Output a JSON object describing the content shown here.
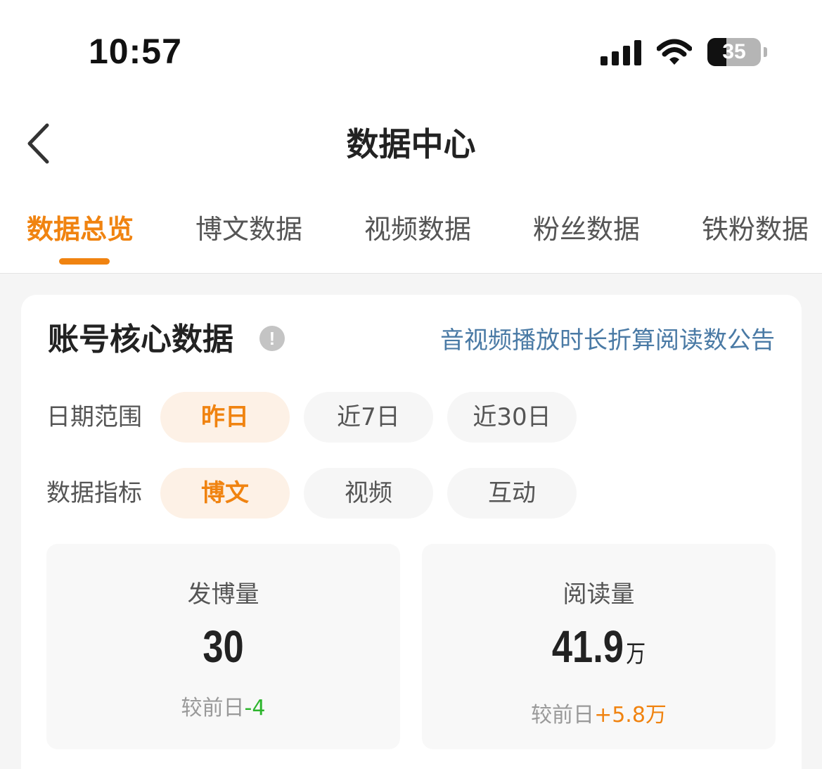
{
  "status_bar": {
    "time": "10:57",
    "battery": "35",
    "icons": [
      "signal-icon",
      "wifi-icon",
      "battery-icon"
    ]
  },
  "nav": {
    "back_icon": "chevron-left-icon",
    "title": "数据中心"
  },
  "tabs": [
    {
      "label": "数据总览",
      "active": true
    },
    {
      "label": "博文数据",
      "active": false
    },
    {
      "label": "视频数据",
      "active": false
    },
    {
      "label": "粉丝数据",
      "active": false
    },
    {
      "label": "铁粉数据",
      "active": false
    }
  ],
  "card": {
    "title": "账号核心数据",
    "info_icon": "exclamation-circle-icon",
    "notice_link": "音视频播放时长折算阅读数公告",
    "date_range": {
      "label": "日期范围",
      "options": [
        "昨日",
        "近7日",
        "近30日"
      ],
      "selected": "昨日"
    },
    "metric": {
      "label": "数据指标",
      "options": [
        "博文",
        "视频",
        "互动"
      ],
      "selected": "博文"
    },
    "stats": [
      {
        "label": "发博量",
        "value": "30",
        "unit": "",
        "compare_prefix": "较前日",
        "compare_value": "-4"
      },
      {
        "label": "阅读量",
        "value": "41.9",
        "unit": "万",
        "compare_prefix": "较前日",
        "compare_value": "+5.8万"
      }
    ]
  },
  "colors": {
    "accent": "#f08310",
    "link": "#4a7aa5",
    "decrease": "#2db52d",
    "chip_active_bg": "#fdf1e6"
  }
}
